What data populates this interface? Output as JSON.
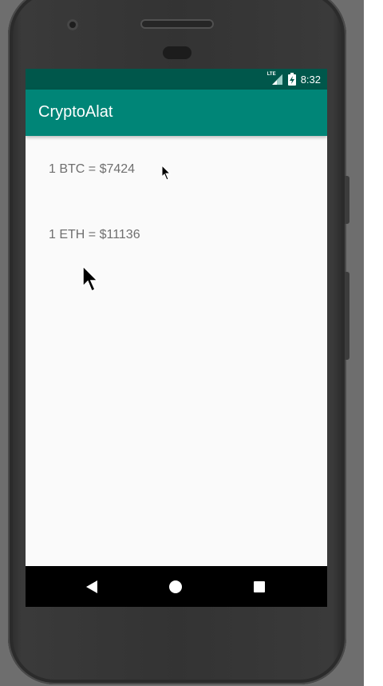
{
  "status_bar": {
    "network_label": "LTE",
    "time": "8:32",
    "icons": [
      "lte-signal-icon",
      "battery-charging-icon"
    ]
  },
  "app_bar": {
    "title": "CryptoAlat"
  },
  "prices": [
    {
      "text": "1 BTC = $7424"
    },
    {
      "text": "1 ETH = $11136"
    }
  ],
  "nav_bar": {
    "icons": [
      "back-icon",
      "home-icon",
      "recents-icon"
    ]
  },
  "colors": {
    "status_bar": "#00574b",
    "app_bar": "#008577",
    "screen_background": "#fafafa",
    "price_text": "#6f6f6f"
  }
}
